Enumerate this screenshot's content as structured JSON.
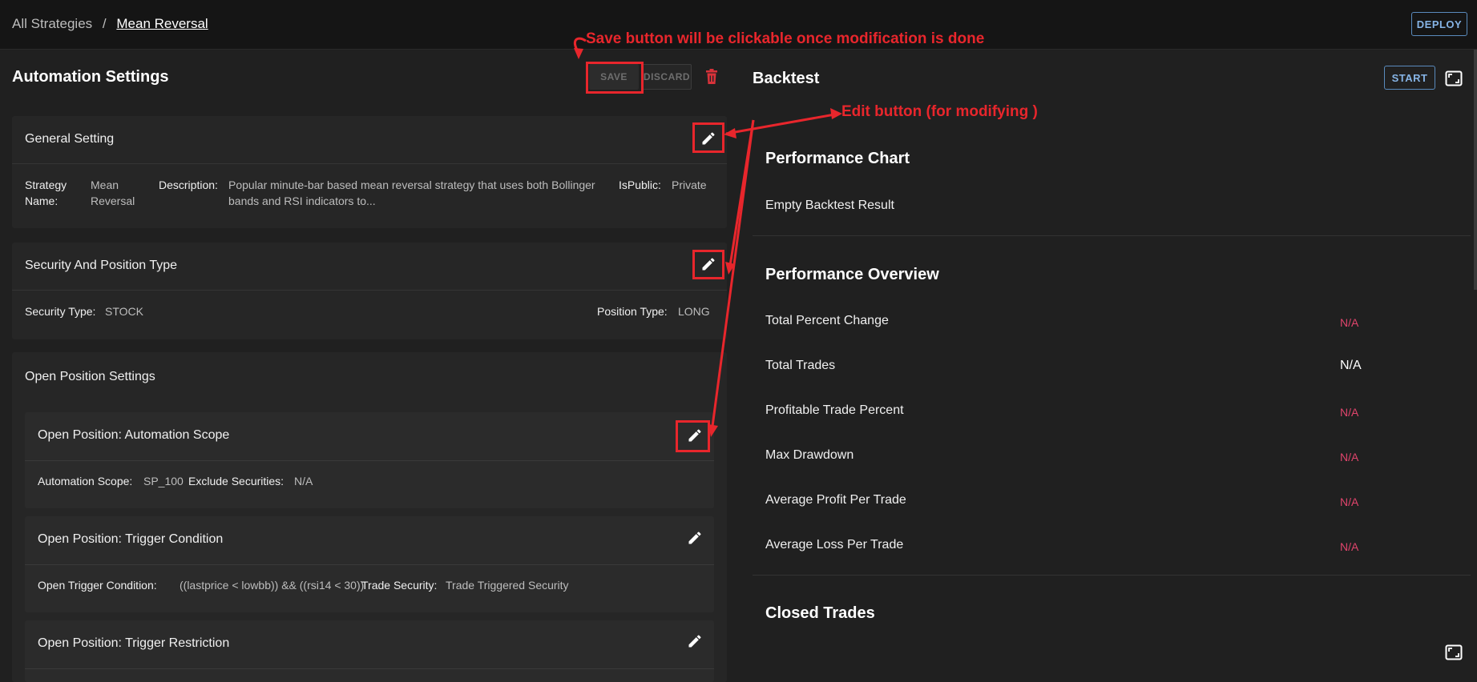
{
  "breadcrumb": {
    "root": "All Strategies",
    "separator": "/",
    "current": "Mean Reversal"
  },
  "toolbar": {
    "deploy_label": "DEPLOY"
  },
  "automation": {
    "title": "Automation Settings",
    "save_label": "SAVE",
    "discard_label": "DISCARD",
    "general": {
      "title": "General Setting",
      "strategy_name_label_1": "Strategy",
      "strategy_name_label_2": "Name:",
      "strategy_name_value_1": "Mean",
      "strategy_name_value_2": "Reversal",
      "description_label": "Description:",
      "description_value_1": "Popular minute-bar based mean reversal strategy that uses both Bollinger",
      "description_value_2": "bands and RSI indicators to...",
      "ispublic_label": "IsPublic:",
      "ispublic_value": "Private"
    },
    "security": {
      "title": "Security And Position Type",
      "security_type_label": "Security Type:",
      "security_type_value": "STOCK",
      "position_type_label": "Position Type:",
      "position_type_value": "LONG"
    },
    "open_position": {
      "title": "Open Position Settings",
      "scope": {
        "title": "Open Position: Automation Scope",
        "scope_label": "Automation Scope:",
        "scope_value": "SP_100",
        "exclude_label": "Exclude Securities:",
        "exclude_value": "N/A"
      },
      "trigger": {
        "title": "Open Position: Trigger Condition",
        "condition_label": "Open Trigger Condition:",
        "condition_value": "((lastprice < lowbb)) && ((rsi14 < 30))",
        "trade_security_label": "Trade Security:",
        "trade_security_value": "Trade Triggered Security"
      },
      "restriction": {
        "title": "Open Position: Trigger Restriction"
      }
    }
  },
  "backtest": {
    "title": "Backtest",
    "start_label": "START",
    "performance_chart": {
      "title": "Performance Chart",
      "empty": "Empty Backtest Result"
    },
    "performance_overview": {
      "title": "Performance Overview",
      "rows": [
        {
          "label": "Total Percent Change",
          "value": "N/A"
        },
        {
          "label": "Total Trades",
          "value": "N/A"
        },
        {
          "label": "Profitable Trade Percent",
          "value": "N/A"
        },
        {
          "label": "Max Drawdown",
          "value": "N/A"
        },
        {
          "label": "Average Profit Per Trade",
          "value": "N/A"
        },
        {
          "label": "Average Loss Per Trade",
          "value": "N/A"
        }
      ]
    },
    "closed_trades": {
      "title": "Closed Trades"
    }
  },
  "annotations": {
    "save_note": "Save button will be clickable once modification is done",
    "edit_note": "Edit button  (for modifying )"
  },
  "colors": {
    "accent_red": "#e8262c",
    "na_red": "#e0446c",
    "outline_blue": "#86b4e6",
    "background": "#202020"
  },
  "icons": [
    "pencil-icon",
    "trash-icon",
    "expand-icon"
  ]
}
